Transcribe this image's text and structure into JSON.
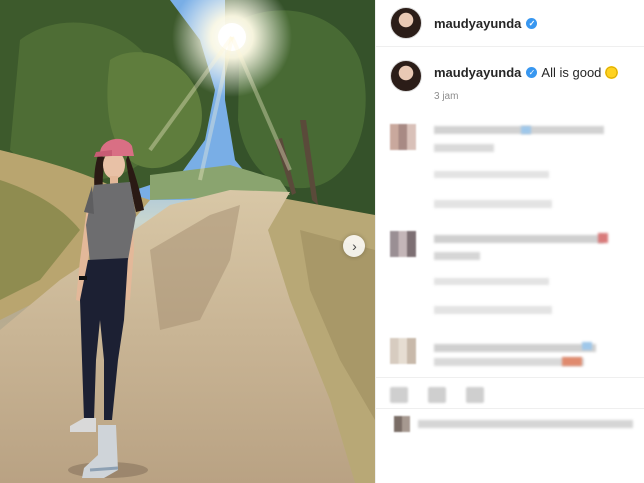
{
  "post": {
    "username": "maudyayunda",
    "verified_mark": "✓",
    "caption_username": "maudyayunda",
    "caption_text": "All is good",
    "caption_emoji": "sun-emoji",
    "time_ago": "3 jam",
    "next_icon": "›"
  },
  "colors": {
    "verified": "#3897f0",
    "muted_text": "#8e8e8e",
    "border": "#efefef"
  },
  "photo": {
    "description_icon": "photo-trail-hiker"
  },
  "comments_blurred": true
}
